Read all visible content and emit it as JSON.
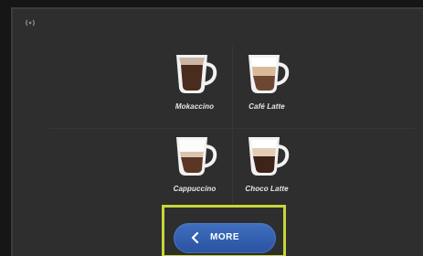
{
  "status": {
    "icon": "wireless-icon"
  },
  "drinks": [
    {
      "label": "Mokaccino",
      "icon": "mocha-cup-icon"
    },
    {
      "label": "Café Latte",
      "icon": "latte-cup-icon"
    },
    {
      "label": "Cappuccino",
      "icon": "cappuccino-cup-icon"
    },
    {
      "label": "Choco Latte",
      "icon": "choco-latte-cup-icon"
    }
  ],
  "more_button": {
    "label": "MORE",
    "icon": "chevron-left-icon"
  },
  "colors": {
    "screen_background": "#2e2e2e",
    "button_blue": "#3a63b5",
    "highlight": "#c5d63a",
    "label_text": "#e8e8e8"
  }
}
